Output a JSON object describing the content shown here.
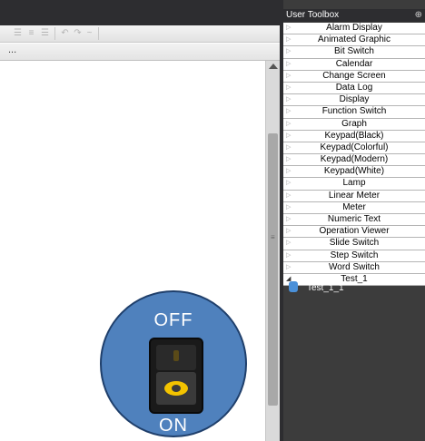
{
  "editor": {
    "toolbar_ellipsis": "...",
    "toolbar_icons": [
      "align-left-icon",
      "align-center-icon",
      "align-right-icon",
      "undo-icon",
      "redo-icon"
    ]
  },
  "switch": {
    "off_label": "OFF",
    "on_label": "ON",
    "circle_color": "#4f81bd",
    "indicator_color": "#f3c300"
  },
  "toolbox": {
    "title": "User Toolbox",
    "items": [
      {
        "label": "Alarm Display"
      },
      {
        "label": "Animated Graphic"
      },
      {
        "label": "Bit Switch"
      },
      {
        "label": "Calendar"
      },
      {
        "label": "Change Screen"
      },
      {
        "label": "Data Log"
      },
      {
        "label": "Display"
      },
      {
        "label": "Function Switch"
      },
      {
        "label": "Graph"
      },
      {
        "label": "Keypad(Black)"
      },
      {
        "label": "Keypad(Colorful)"
      },
      {
        "label": "Keypad(Modern)"
      },
      {
        "label": "Keypad(White)"
      },
      {
        "label": "Lamp"
      },
      {
        "label": "Linear Meter"
      },
      {
        "label": "Meter"
      },
      {
        "label": "Numeric Text"
      },
      {
        "label": "Operation Viewer"
      },
      {
        "label": "Slide Switch"
      },
      {
        "label": "Step Switch"
      },
      {
        "label": "Word Switch"
      },
      {
        "label": "Test_1",
        "expanded": true
      }
    ],
    "child": {
      "label": "Test_1_1"
    }
  }
}
